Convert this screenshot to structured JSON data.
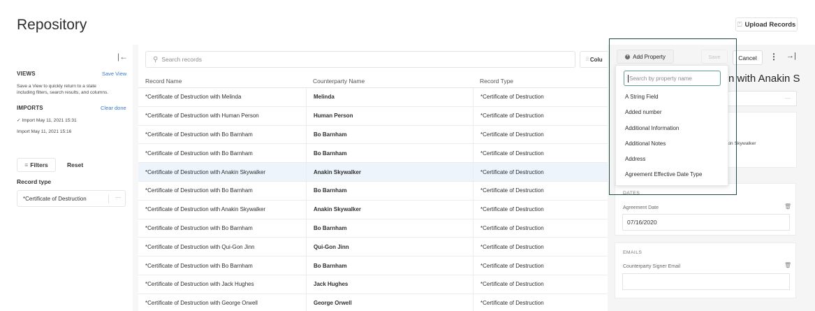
{
  "header": {
    "title": "Repository",
    "upload_label": "Upload Records",
    "upload_icon": "upload-icon"
  },
  "sidebar": {
    "collapse_icon": "collapse-left-icon",
    "views": {
      "title": "VIEWS",
      "action": "Save View",
      "description_line1": "Save a View to quickly return to a state",
      "description_line2": "including filters, search results, and columns."
    },
    "imports": {
      "title": "IMPORTS",
      "action": "Clear done",
      "items": [
        "✓ Import May 11, 2021 15:31",
        "Import May 11, 2021 15:16"
      ]
    },
    "filters_label": "Filters",
    "reset_label": "Reset",
    "record_type_label": "Record type",
    "record_type_value": "*Certificate of Destruction"
  },
  "main": {
    "search_placeholder": "Search records",
    "columns_label": "Colu",
    "headers": [
      "Record Name",
      "Counterparty Name",
      "Record Type"
    ],
    "rows": [
      {
        "name": "*Certificate of Destruction with Melinda",
        "counterparty": "Melinda",
        "type": "*Certificate of Destruction"
      },
      {
        "name": "*Certificate of Destruction with Human Person",
        "counterparty": "Human Person",
        "type": "*Certificate of Destruction"
      },
      {
        "name": "*Certificate of Destruction with Bo Barnham",
        "counterparty": "Bo Barnham",
        "type": "*Certificate of Destruction"
      },
      {
        "name": "*Certificate of Destruction with Bo Barnham",
        "counterparty": "Bo Barnham",
        "type": "*Certificate of Destruction"
      },
      {
        "name": "*Certificate of Destruction with Anakin Skywalker",
        "counterparty": "Anakin Skywalker",
        "type": "*Certificate of Destruction"
      },
      {
        "name": "*Certificate of Destruction with Bo Barnham",
        "counterparty": "Bo Barnham",
        "type": "*Certificate of Destruction"
      },
      {
        "name": "*Certificate of Destruction with Anakin Skywalker",
        "counterparty": "Anakin Skywalker",
        "type": "*Certificate of Destruction"
      },
      {
        "name": "*Certificate of Destruction with Bo Barnham",
        "counterparty": "Bo Barnham",
        "type": "*Certificate of Destruction"
      },
      {
        "name": "*Certificate of Destruction with Qui-Gon Jinn",
        "counterparty": "Qui-Gon Jinn",
        "type": "*Certificate of Destruction"
      },
      {
        "name": "*Certificate of Destruction with Bo Barnham",
        "counterparty": "Bo Barnham",
        "type": "*Certificate of Destruction"
      },
      {
        "name": "*Certificate of Destruction with Jack Hughes",
        "counterparty": "Jack Hughes",
        "type": "*Certificate of Destruction"
      },
      {
        "name": "*Certificate of Destruction with George Orwell",
        "counterparty": "George Orwell",
        "type": "*Certificate of Destruction"
      }
    ]
  },
  "panel": {
    "add_property_label": "Add Property",
    "save_label": "Save",
    "cancel_label": "Cancel",
    "title_visible": "n with Anakin S",
    "snippet_visible": "kin Skywalker",
    "dates_section": "DATES",
    "agreement_date_label": "Agreement Date",
    "agreement_date_value": "07/16/2020",
    "emails_section": "EMAILS",
    "signer_email_label": "Counterparty Signer Email",
    "signer_email_value": "",
    "dropdown": {
      "search_placeholder": "Search by property name",
      "options": [
        "A String Field",
        "Added number",
        "Additional Information",
        "Additional Notes",
        "Address",
        "Agreement Effective Date Type"
      ]
    }
  },
  "colors": {
    "accent_link": "#3a79c6",
    "selected_row": "#edf4fb",
    "highlight_border": "#1f4a45",
    "focus_ring": "#5a9e95"
  }
}
